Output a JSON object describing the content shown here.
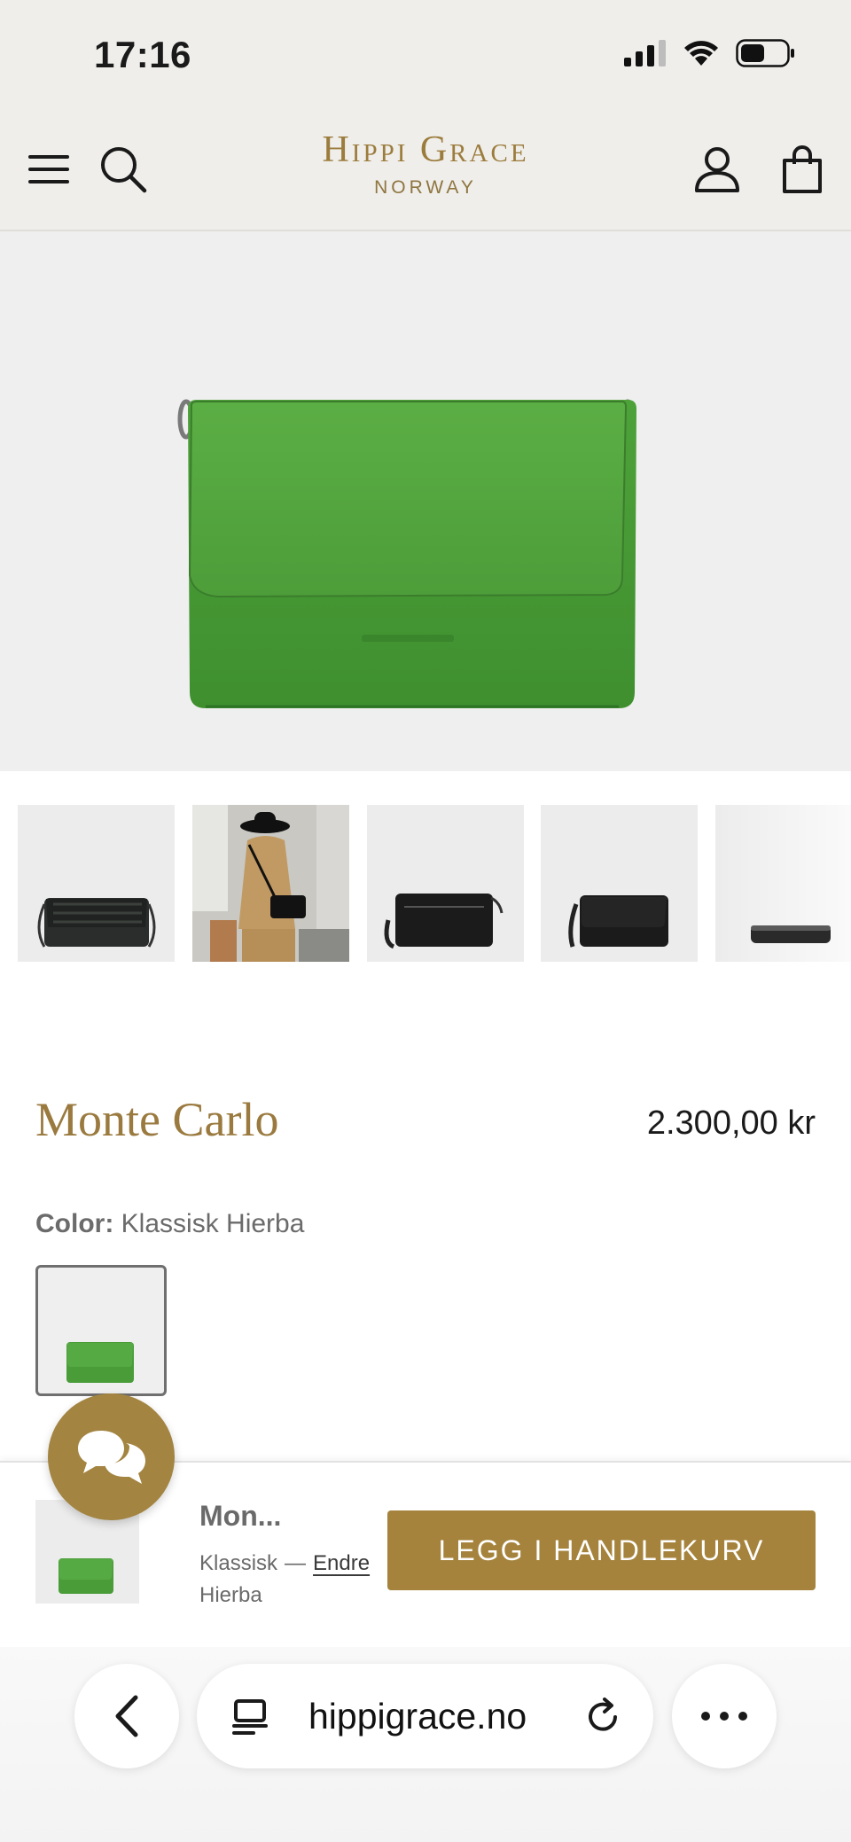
{
  "status_bar": {
    "time": "17:16"
  },
  "header": {
    "brand_main": "Hippi Grace",
    "brand_sub": "NORWAY"
  },
  "product": {
    "title": "Monte Carlo",
    "price": "2.300,00 kr",
    "color_label": "Color:",
    "color_value": "Klassisk Hierba"
  },
  "sticky_bar": {
    "name": "Mon...",
    "variant_line1": "Klassisk",
    "variant_dash": "—",
    "edit_label": "Endre",
    "variant_line2": "Hierba",
    "add_to_cart_label": "LEGG I HANDLEKURV"
  },
  "browser": {
    "url": "hippigrace.no"
  },
  "colors": {
    "brand_gold": "#a5833c",
    "header_bg": "#efeeeb",
    "bag_green": "#4f9e3c"
  },
  "icons": [
    "menu-icon",
    "search-icon",
    "account-icon",
    "cart-icon",
    "chat-icon",
    "back-icon",
    "tabs-icon",
    "reload-icon",
    "more-icon"
  ]
}
